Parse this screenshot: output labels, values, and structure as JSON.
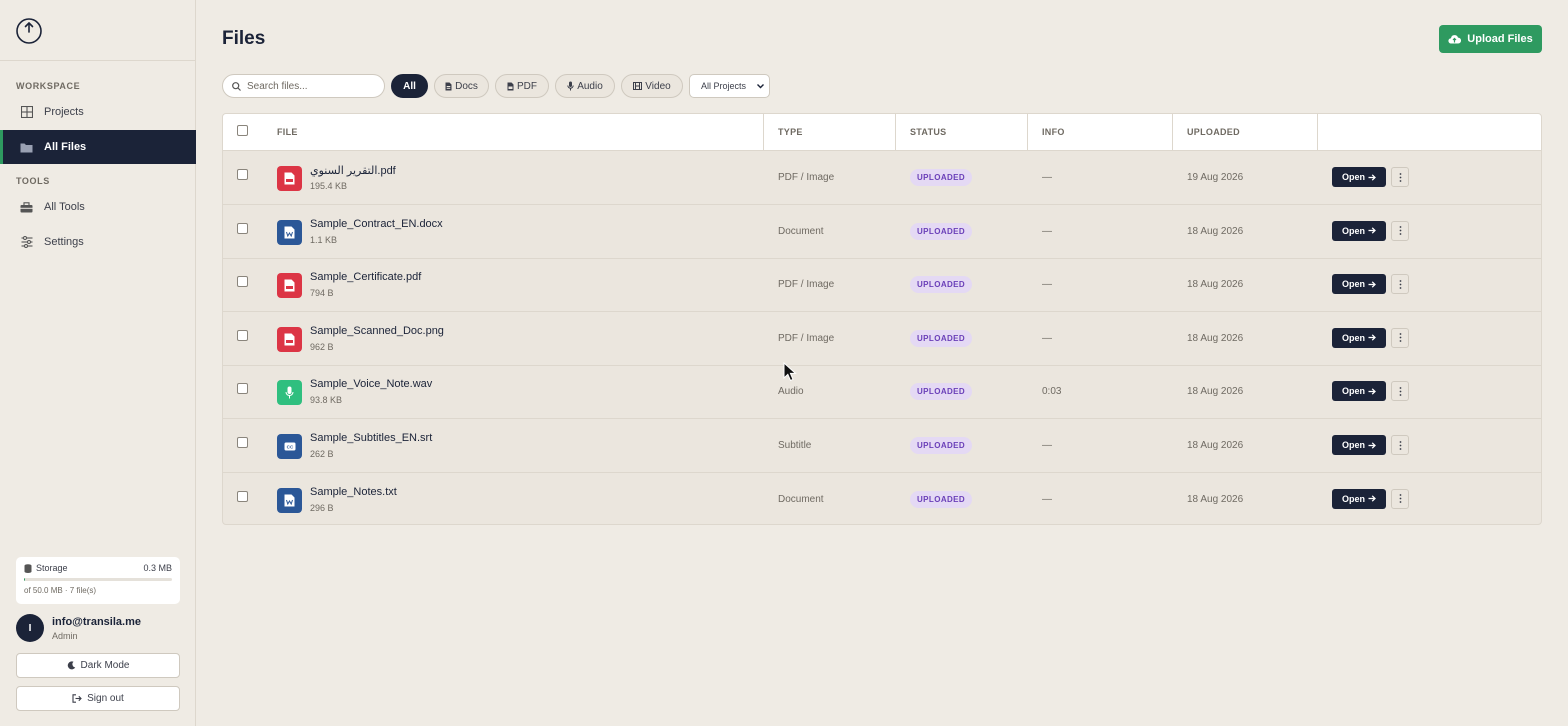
{
  "sidebar": {
    "logo_icon": "power-circle-icon",
    "workspace_label": "WORKSPACE",
    "tools_label": "TOOLS",
    "items": [
      {
        "label": "Projects",
        "icon": "grid-icon"
      },
      {
        "label": "All Files",
        "icon": "folder-icon",
        "active": true
      },
      {
        "label": "All Tools",
        "icon": "toolbox-icon"
      },
      {
        "label": "Settings",
        "icon": "sliders-icon"
      }
    ],
    "storage": {
      "label": "Storage",
      "used": "0.3 MB",
      "detail": "of 50.0 MB · 7 file(s)",
      "fill_fraction": 0.006
    },
    "user": {
      "initial": "I",
      "email": "info@transila.me",
      "role": "Admin"
    },
    "dark_mode_label": "Dark Mode",
    "sign_out_label": "Sign out"
  },
  "header": {
    "title": "Files",
    "upload_label": "Upload Files"
  },
  "filters": {
    "search_placeholder": "Search files...",
    "chips": [
      {
        "label": "All",
        "active": true
      },
      {
        "label": "Docs",
        "icon": "doc-icon"
      },
      {
        "label": "PDF",
        "icon": "pdf-icon"
      },
      {
        "label": "Audio",
        "icon": "mic-icon"
      },
      {
        "label": "Video",
        "icon": "film-icon"
      }
    ],
    "project_select": "All Projects"
  },
  "table": {
    "columns": [
      "FILE",
      "TYPE",
      "STATUS",
      "INFO",
      "UPLOADED"
    ],
    "open_label": "Open",
    "rows": [
      {
        "name": "التقرير السنوي.pdf",
        "size": "195.4 KB",
        "type": "PDF / Image",
        "status": "UPLOADED",
        "info": "—",
        "uploaded": "19 Aug 2026",
        "icon": "pdf-icon",
        "color": "#dc3545"
      },
      {
        "name": "Sample_Contract_EN.docx",
        "size": "1.1 KB",
        "type": "Document",
        "status": "UPLOADED",
        "info": "—",
        "uploaded": "18 Aug 2026",
        "icon": "word-icon",
        "color": "#2b5797"
      },
      {
        "name": "Sample_Certificate.pdf",
        "size": "794 B",
        "type": "PDF / Image",
        "status": "UPLOADED",
        "info": "—",
        "uploaded": "18 Aug 2026",
        "icon": "pdf-icon",
        "color": "#dc3545"
      },
      {
        "name": "Sample_Scanned_Doc.png",
        "size": "962 B",
        "type": "PDF / Image",
        "status": "UPLOADED",
        "info": "—",
        "uploaded": "18 Aug 2026",
        "icon": "pdf-icon",
        "color": "#dc3545"
      },
      {
        "name": "Sample_Voice_Note.wav",
        "size": "93.8 KB",
        "type": "Audio",
        "status": "UPLOADED",
        "info": "0:03",
        "uploaded": "18 Aug 2026",
        "icon": "mic-icon",
        "color": "#2fbf7f"
      },
      {
        "name": "Sample_Subtitles_EN.srt",
        "size": "262 B",
        "type": "Subtitle",
        "status": "UPLOADED",
        "info": "—",
        "uploaded": "18 Aug 2026",
        "icon": "cc-icon",
        "color": "#2b5797"
      },
      {
        "name": "Sample_Notes.txt",
        "size": "296 B",
        "type": "Document",
        "status": "UPLOADED",
        "info": "—",
        "uploaded": "18 Aug 2026",
        "icon": "word-icon",
        "color": "#2b5797"
      }
    ]
  }
}
